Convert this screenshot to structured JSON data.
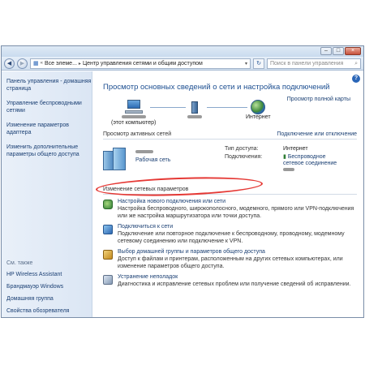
{
  "address": {
    "crumbs": [
      "Все элеме...",
      "Центр управления сетями и общим доступом"
    ],
    "search_placeholder": "Поиск в панели управления"
  },
  "sidebar": {
    "items": [
      "Панель управления - домашняя страница",
      "Управление беспроводными сетями",
      "Изменение параметров адаптера",
      "Изменить дополнительные параметры общего доступа"
    ],
    "see_also_title": "См. также",
    "see_also": [
      "HP Wireless Assistant",
      "Брандмауэр Windows",
      "Домашняя группа",
      "Свойства обозревателя"
    ]
  },
  "main": {
    "heading": "Просмотр основных сведений о сети и настройка подключений",
    "full_map": "Просмотр полной карты",
    "this_computer": "(этот компьютер)",
    "internet": "Интернет",
    "active_networks": "Просмотр активных сетей",
    "connect_disconnect": "Подключение или отключение",
    "network_type": "Рабочая сеть",
    "access_type_label": "Тип доступа:",
    "access_type_value": "Интернет",
    "connections_label": "Подключения:",
    "connections_value": "Беспроводное сетевое соединение",
    "change_settings": "Изменение сетевых параметров",
    "tasks": [
      {
        "title": "Настройка нового подключения или сети",
        "desc": "Настройка беспроводного, широкополосного, модемного, прямого или VPN-подключения или же настройка маршрутизатора или точки доступа."
      },
      {
        "title": "Подключиться к сети",
        "desc": "Подключение или повторное подключение к беспроводному, проводному, модемному сетевому соединению или подключение к VPN."
      },
      {
        "title": "Выбор домашней группы и параметров общего доступа",
        "desc": "Доступ к файлам и принтерам, расположенным на других сетевых компьютерах, или изменение параметров общего доступа."
      },
      {
        "title": "Устранение неполадок",
        "desc": "Диагностика и исправление сетевых проблем или получение сведений об исправлении."
      }
    ]
  },
  "colors": {
    "link": "#1a3f73",
    "heading": "#1d4f91",
    "highlight": "#e53935"
  }
}
